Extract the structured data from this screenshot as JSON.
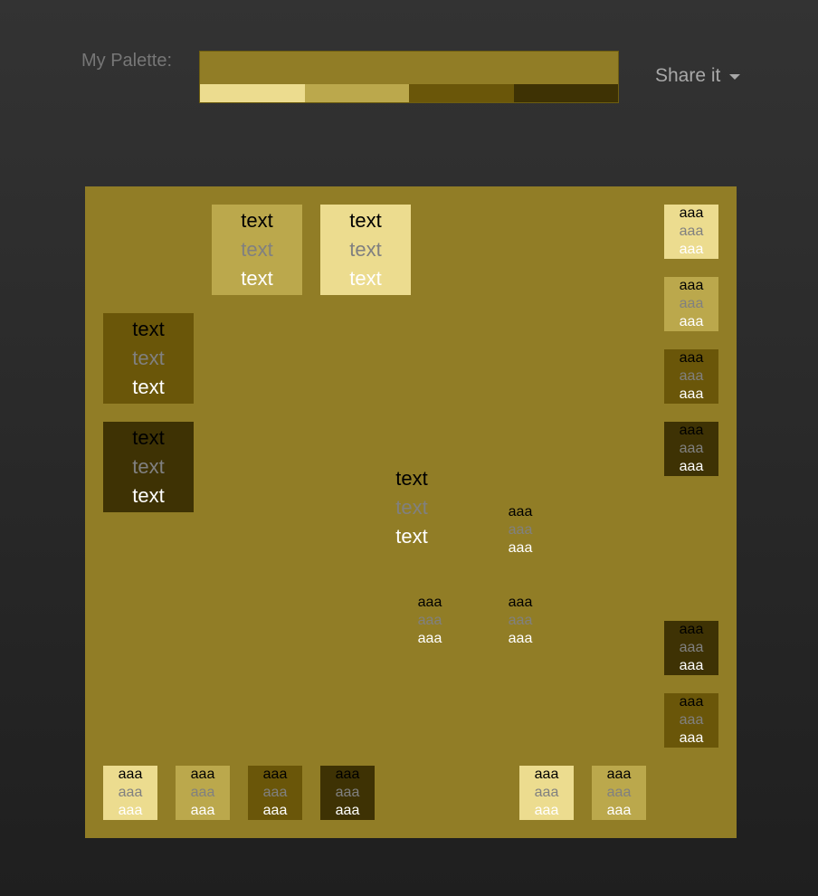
{
  "header": {
    "palette_label": "My Palette:",
    "share_label": "Share it",
    "share_icon": "caret-down-icon"
  },
  "colors": {
    "base": "#917d26",
    "shade1": "#ecdc8f",
    "shade2": "#bba84c",
    "shade3": "#6a5609",
    "shade4": "#3e3204",
    "text_black": "#000000",
    "text_gray": "#808080",
    "text_white": "#ffffff"
  },
  "palette_swatches": [
    "#ecdc8f",
    "#bba84c",
    "#6a5609",
    "#3e3204"
  ],
  "tiles": {
    "big_text": [
      "text",
      "text",
      "text"
    ],
    "small_text": [
      "aaa",
      "aaa",
      "aaa"
    ]
  }
}
